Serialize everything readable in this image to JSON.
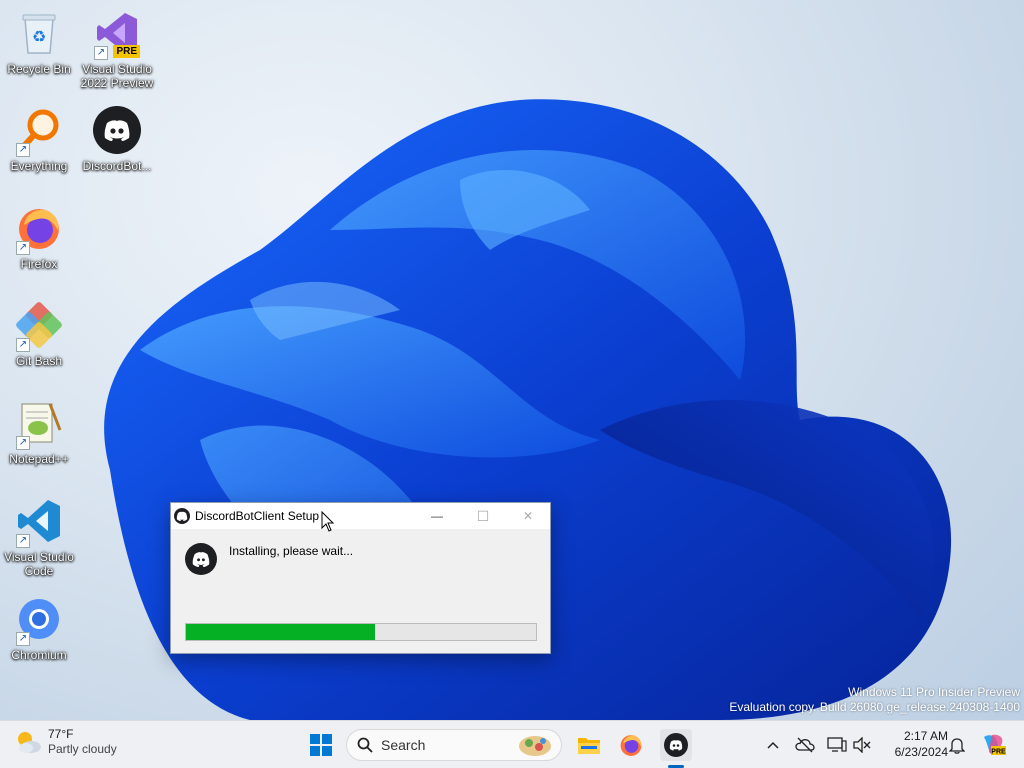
{
  "desktop": {
    "icons": [
      {
        "name": "recycle-bin",
        "label": "Recycle Bin"
      },
      {
        "name": "visual-studio-2022-preview",
        "label": "Visual Studio\n2022 Preview",
        "badge": "PRE"
      },
      {
        "name": "everything",
        "label": "Everything"
      },
      {
        "name": "discordbot",
        "label": "DiscordBot..."
      },
      {
        "name": "firefox",
        "label": "Firefox"
      },
      {
        "name": "git-bash",
        "label": "Git Bash"
      },
      {
        "name": "notepad-plus-plus",
        "label": "Notepad++"
      },
      {
        "name": "visual-studio-code",
        "label": "Visual Studio\nCode"
      },
      {
        "name": "chromium",
        "label": "Chromium"
      }
    ]
  },
  "dialog": {
    "title": "DiscordBotClient Setup",
    "status": "Installing, please wait...",
    "progress": 0.54,
    "minimize_glyph": "—",
    "maximize_glyph": "☐",
    "close_glyph": "✕"
  },
  "watermark": {
    "line1": "Windows 11 Pro Insider Preview",
    "line2": "Evaluation copy. Build 26080.ge_release.240308-1400"
  },
  "taskbar": {
    "weather": {
      "temp": "77°F",
      "condition": "Partly cloudy",
      "icon": "partly-cloudy-icon"
    },
    "search_label": "Search",
    "apps": [
      "start",
      "search",
      "file-explorer",
      "firefox",
      "discordbotclient"
    ],
    "active_app": "discordbotclient",
    "clock": {
      "time": "2:17 AM",
      "date": "6/23/2024"
    }
  },
  "colors": {
    "progress_fill": "#06b025",
    "accent": "#0067c0",
    "discord_dark": "#1e1f22"
  }
}
